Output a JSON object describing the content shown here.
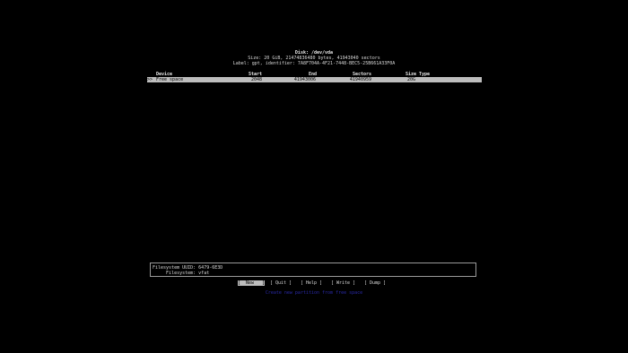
{
  "disk": {
    "title": "Disk: /dev/vda",
    "size_line": "Size: 20 GiB, 21474836480 bytes, 41943040 sectors",
    "label_line": "Label: gpt, identifier: 7A8F704A-4F21-7448-BEC5-25B661A33F0A"
  },
  "table": {
    "headers": {
      "device": "Device",
      "start": "Start",
      "end": "End",
      "sectors": "Sectors",
      "size": "Size",
      "type": "Type"
    },
    "rows": [
      {
        "marker": ">>",
        "device": "Free space",
        "start": "2048",
        "end": "41943006",
        "sectors": "41940959",
        "size": "20G"
      }
    ]
  },
  "info": {
    "line1": "Filesystem UUID: 6479-6E3D",
    "line2": "     Filesystem: vfat"
  },
  "menu": {
    "new": "[  New   ]",
    "quit": "[ Quit ]",
    "help": "[ Help ]",
    "write": "[ Write ]",
    "dump": "[ Dump ]"
  },
  "hint": "Create new partition from free space",
  "colors": {
    "background": "#000000",
    "text": "#d8d8d8",
    "selection_bg": "#bdbdbd",
    "hint": "#2a2aa8"
  }
}
